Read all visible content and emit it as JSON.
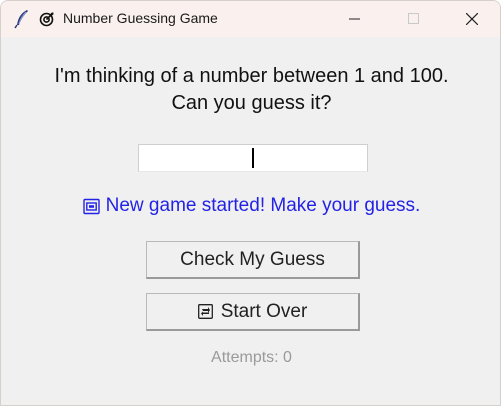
{
  "window": {
    "title": "Number Guessing Game",
    "tk_icon": "feather-icon",
    "app_icon": "target-icon",
    "controls": [
      "minimize-icon",
      "maximize-icon",
      "close-icon"
    ]
  },
  "prompt": {
    "line1": "I'm thinking of a number between 1 and 100.",
    "line2": "Can you guess it?"
  },
  "guess_input": {
    "value": "",
    "placeholder": ""
  },
  "status": {
    "icon": "new-game-icon",
    "text": "New game started! Make your guess.",
    "color": "#2323e6"
  },
  "buttons": {
    "check": "Check My Guess",
    "reset": "Start Over",
    "reset_icon": "restart-icon"
  },
  "attempts": {
    "text": "Attempts: 0"
  }
}
